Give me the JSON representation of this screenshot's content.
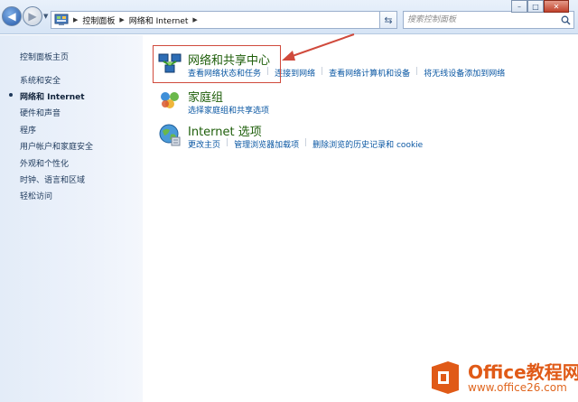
{
  "window": {
    "min_glyph": "–",
    "max_glyph": "□",
    "close_glyph": "✕"
  },
  "address_bar": {
    "crumbs": [
      "控制面板",
      "网络和 Internet"
    ],
    "refresh_glyph": "⇆"
  },
  "search": {
    "placeholder": "搜索控制面板"
  },
  "sidebar": {
    "items": [
      {
        "label": "控制面板主页"
      },
      {
        "label": "系统和安全"
      },
      {
        "label": "网络和 Internet"
      },
      {
        "label": "硬件和声音"
      },
      {
        "label": "程序"
      },
      {
        "label": "用户帐户和家庭安全"
      },
      {
        "label": "外观和个性化"
      },
      {
        "label": "时钟、语言和区域"
      },
      {
        "label": "轻松访问"
      }
    ]
  },
  "categories": [
    {
      "title": "网络和共享中心",
      "icon": "network-sharing-icon",
      "links": [
        "查看网络状态和任务",
        "连接到网络",
        "查看网络计算机和设备",
        "将无线设备添加到网络"
      ]
    },
    {
      "title": "家庭组",
      "icon": "homegroup-icon",
      "links": [
        "选择家庭组和共享选项"
      ]
    },
    {
      "title": "Internet 选项",
      "icon": "internet-options-icon",
      "links": [
        "更改主页",
        "管理浏览器加载项",
        "删除浏览的历史记录和 cookie"
      ]
    }
  ],
  "watermark": {
    "brand": "Office教程网",
    "url": "www.office26.com"
  },
  "colors": {
    "accent_red": "#d04a3c",
    "link_blue": "#0a57a3",
    "title_green": "#1e5e0a",
    "brand_orange": "#e05a17"
  }
}
